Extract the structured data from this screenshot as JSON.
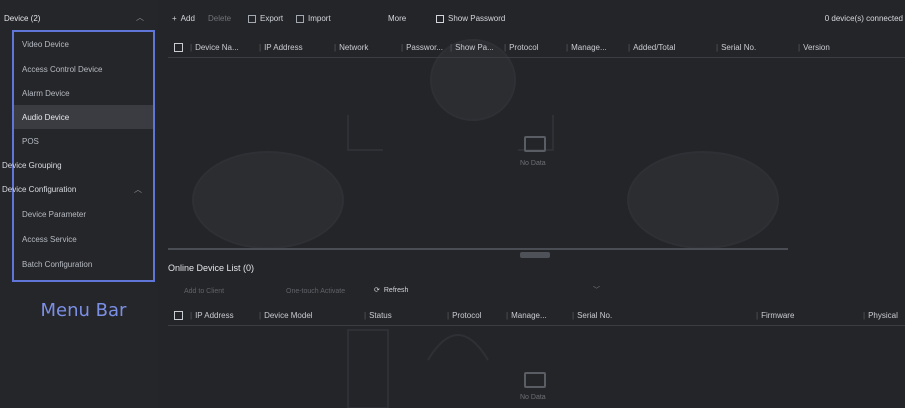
{
  "sidebar": {
    "header": "Device (2)",
    "items": [
      {
        "label": "Video Device"
      },
      {
        "label": "Access Control Device"
      },
      {
        "label": "Alarm Device"
      },
      {
        "label": "Audio Device"
      },
      {
        "label": "POS"
      }
    ],
    "grouping": "Device Grouping",
    "configuration": {
      "label": "Device Configuration",
      "items": [
        {
          "label": "Device Parameter"
        },
        {
          "label": "Access Service"
        },
        {
          "label": "Batch Configuration"
        }
      ]
    },
    "caption": "Menu Bar"
  },
  "toolbar": {
    "add": "Add",
    "delete": "Delete",
    "export": "Export",
    "import": "Import",
    "more": "More",
    "show_password": "Show Password",
    "connected": "0 device(s) connected"
  },
  "device_table": {
    "columns": [
      "Device Na...",
      "IP Address",
      "Network",
      "Passwor...",
      "Show Pa...",
      "Protocol",
      "Manage...",
      "Added/Total",
      "Serial No.",
      "Version"
    ],
    "empty_text": "No Data"
  },
  "online": {
    "title": "Online Device List (0)",
    "add_to_client": "Add to Client",
    "one_touch": "One-touch Activate",
    "refresh": "Refresh",
    "columns": [
      "IP Address",
      "Device Model",
      "Status",
      "Protocol",
      "Manage...",
      "Serial No.",
      "Firmware",
      "Physical"
    ],
    "empty_text": "No Data"
  },
  "colors": {
    "accent": "#5f76d8",
    "background": "#242528"
  }
}
